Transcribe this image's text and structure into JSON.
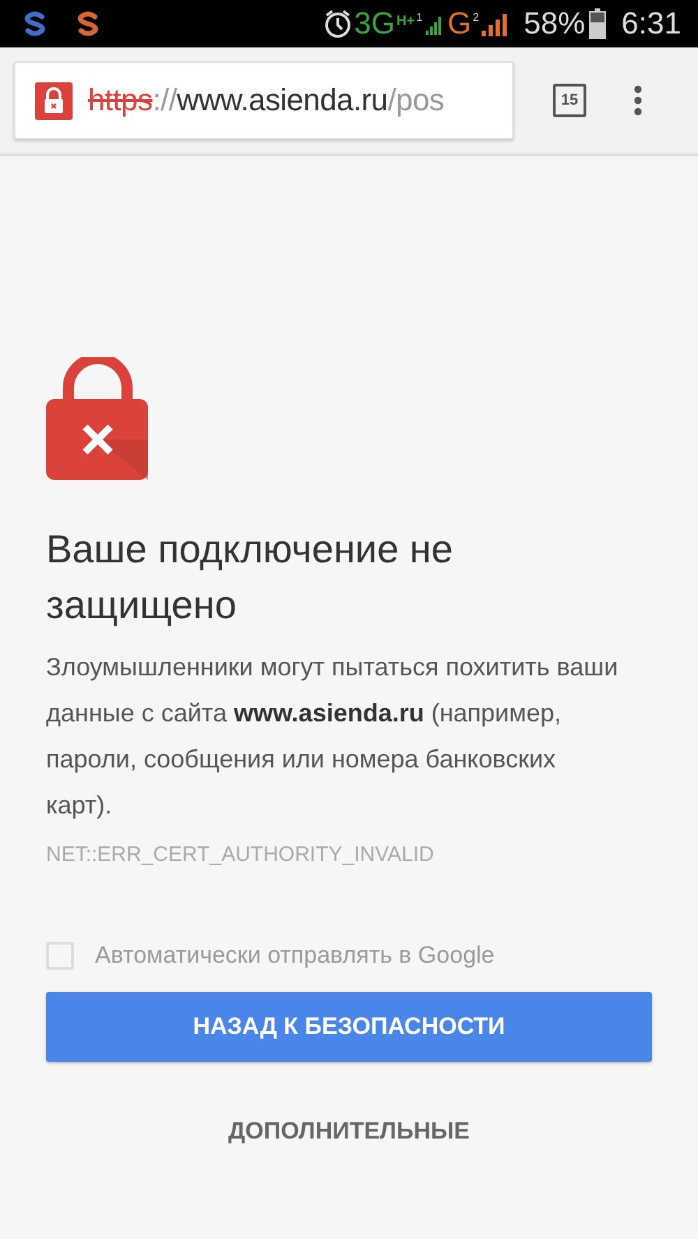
{
  "status_bar": {
    "network_labels": [
      {
        "text": "3G",
        "color": "#3aa53a"
      },
      {
        "text": "H+",
        "color": "#3aa53a"
      },
      {
        "text": "1",
        "color": "#cccccc"
      },
      {
        "text": "G",
        "color": "#e0702a"
      },
      {
        "text": "2",
        "color": "#cccccc"
      }
    ],
    "battery": "58%",
    "time": "6:31"
  },
  "toolbar": {
    "url_parts": [
      {
        "text": "https",
        "kind": "scheme"
      },
      {
        "text": "://",
        "kind": "muted"
      },
      {
        "text": "www.asienda.ru",
        "kind": "host"
      },
      {
        "text": "/pos",
        "kind": "muted"
      }
    ],
    "tab_count": "15"
  },
  "page": {
    "title": "Ваше подключение не защищено",
    "message": "Злоумышленники могут пытаться похитить ваши данные с сайта **www.asienda.ru** (например, пароли, сообщения или номера банковских карт).",
    "error_code": "NET::ERR_CERT_AUTHORITY_INVALID",
    "report_option": {
      "label": "Автоматически отправлять в Google",
      "checked": false,
      "disabled": true
    },
    "primary_button": "НАЗАД К БЕЗОПАСНОСТИ",
    "secondary_button": "ДОПОЛНИТЕЛЬНЫЕ"
  }
}
